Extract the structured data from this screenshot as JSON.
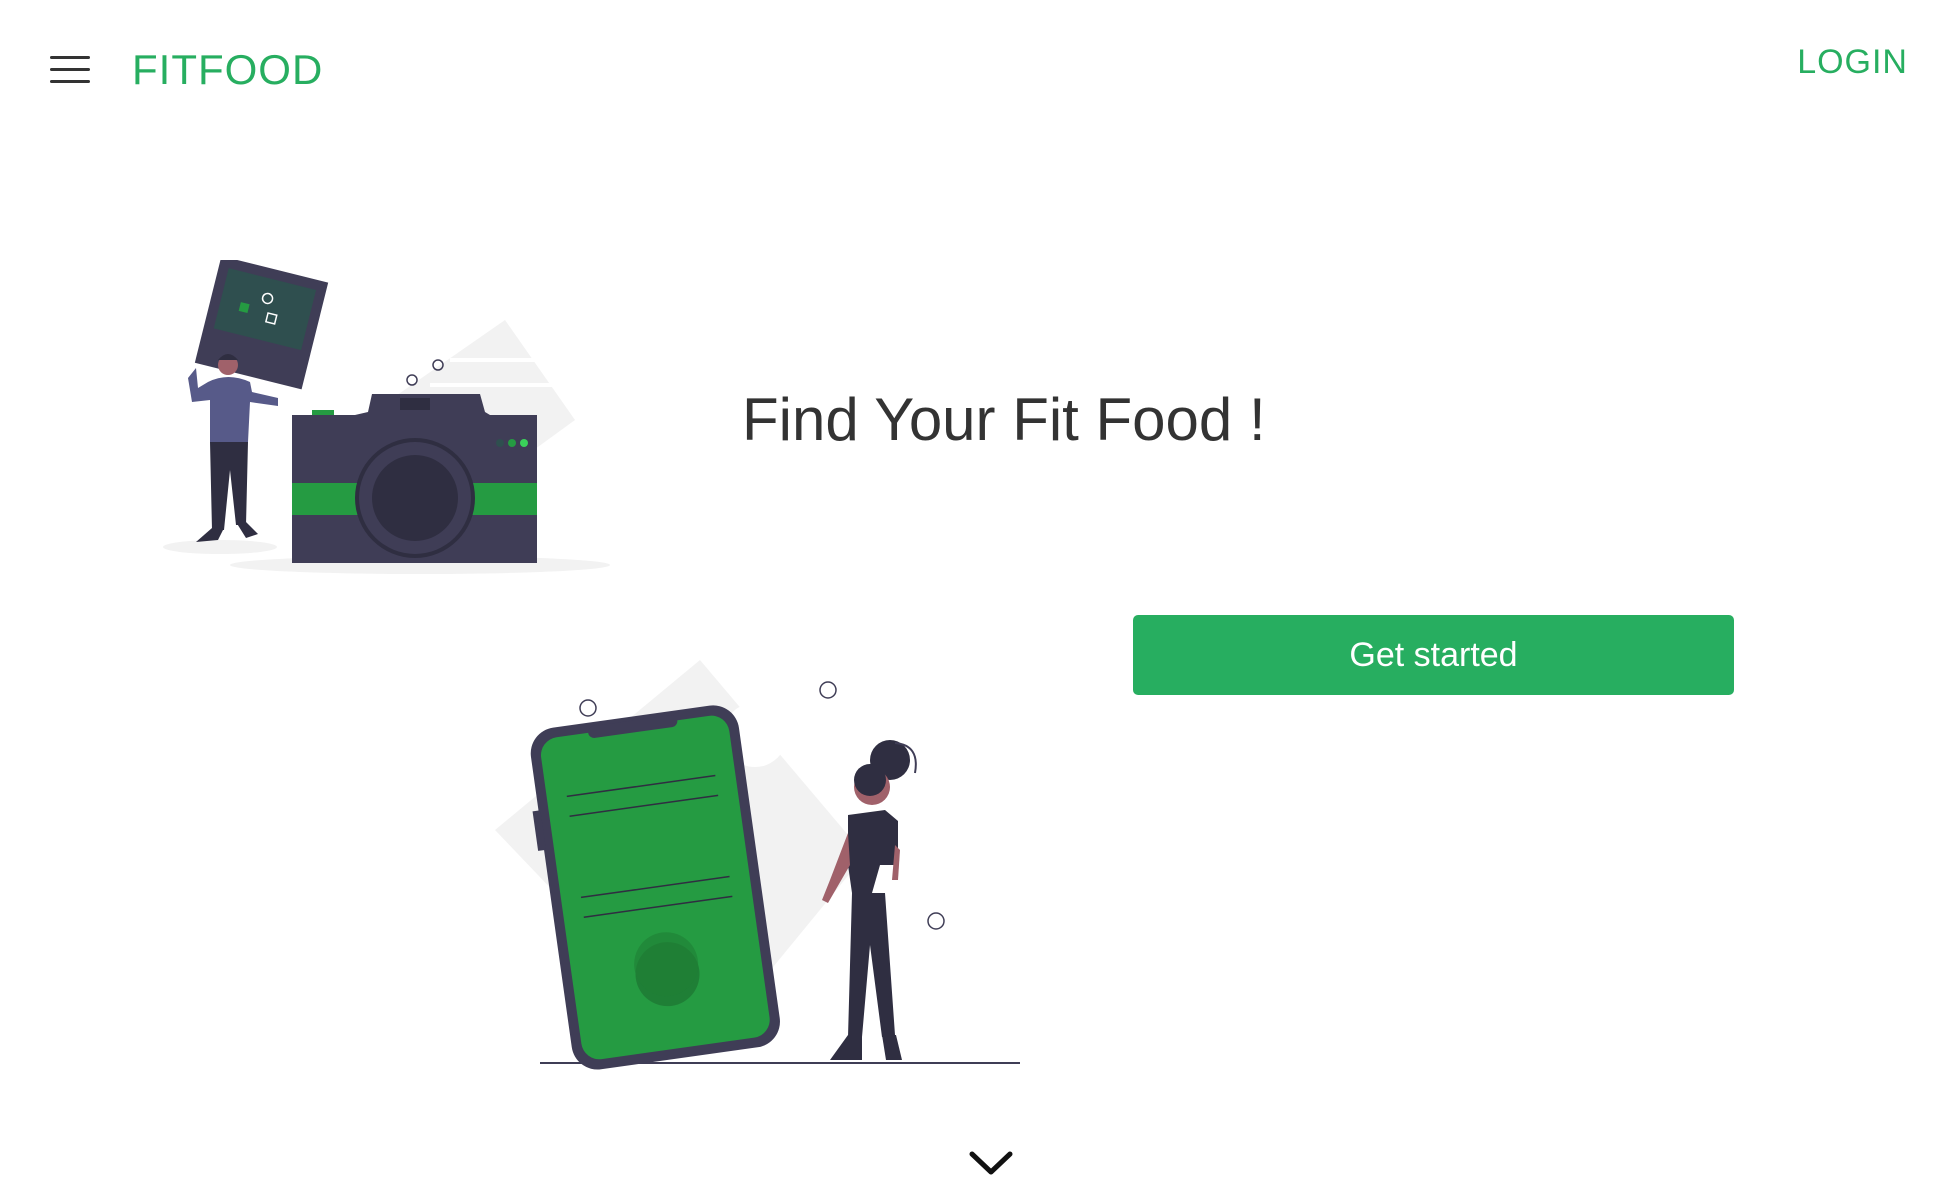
{
  "header": {
    "brand": "FITFOOD",
    "login_label": "LOGIN",
    "menu_icon": "hamburger-menu-icon"
  },
  "hero": {
    "title": "Find Your Fit Food !",
    "cta_label": "Get started",
    "scroll_icon": "chevron-down-icon"
  },
  "colors": {
    "accent": "#27ae60",
    "illustration_green": "#259b42",
    "illustration_dark": "#3f3d56",
    "text": "#333333"
  }
}
